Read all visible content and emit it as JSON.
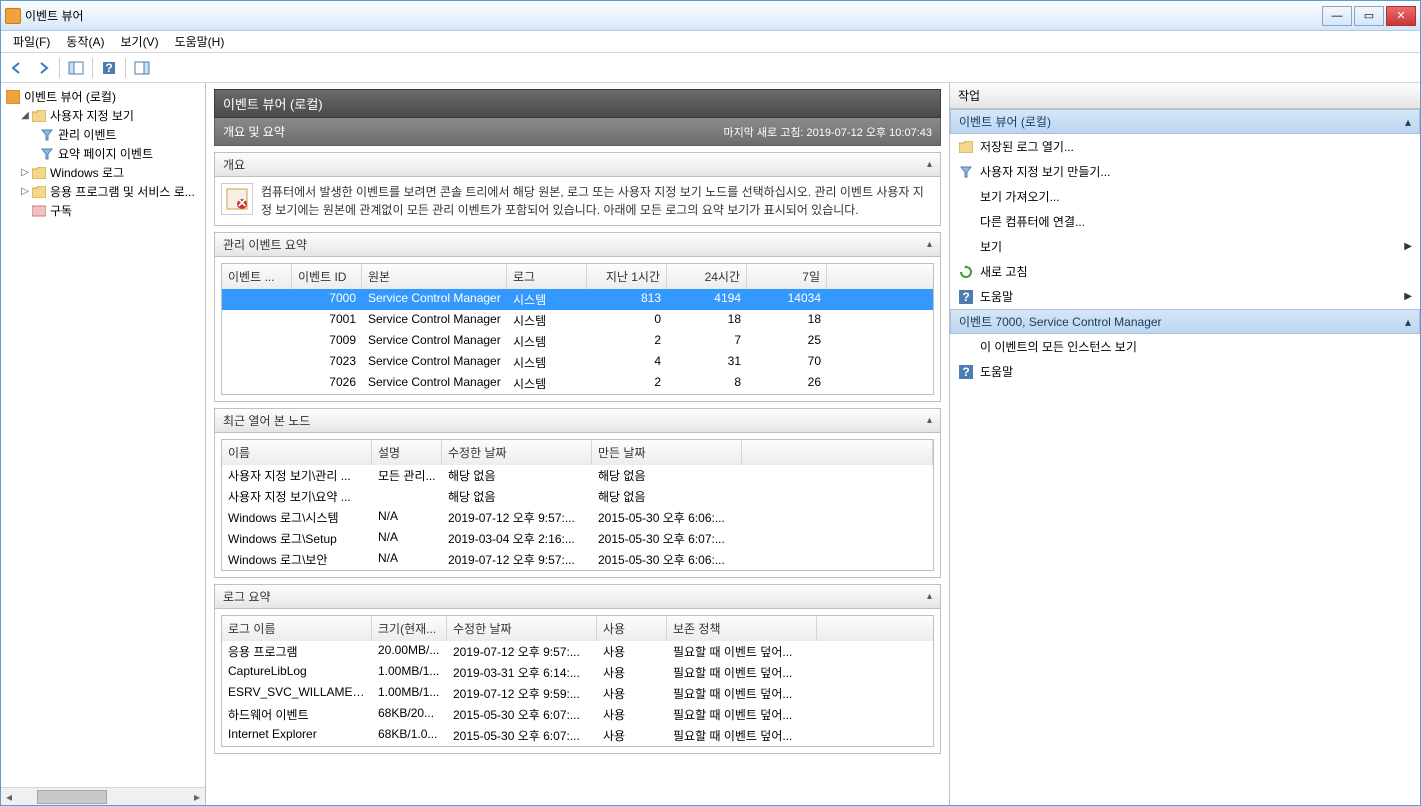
{
  "window": {
    "title": "이벤트 뷰어"
  },
  "menu": {
    "file": "파일(F)",
    "action": "동작(A)",
    "view": "보기(V)",
    "help": "도움말(H)"
  },
  "tree": {
    "root": "이벤트 뷰어 (로컬)",
    "custom_views": "사용자 지정 보기",
    "admin_events": "관리 이벤트",
    "summary_page_events": "요약 페이지 이벤트",
    "windows_logs": "Windows 로그",
    "app_service_logs": "응용 프로그램 및 서비스 로...",
    "subscriptions": "구독"
  },
  "center": {
    "title": "이벤트 뷰어 (로컬)",
    "subtitle": "개요 및 요약",
    "last_refresh": "마지막 새로 고침: 2019-07-12 오후 10:07:43",
    "overview_header": "개요",
    "overview_text": "컴퓨터에서 발생한 이벤트를 보려면 콘솔 트리에서 해당 원본, 로그 또는 사용자 지정 보기 노드를 선택하십시오. 관리 이벤트 사용자 지정 보기에는 원본에 관계없이 모든 관리 이벤트가 포함되어 있습니다. 아래에 모든 로그의 요약 보기가 표시되어 있습니다.",
    "admin_summary_header": "관리 이벤트 요약",
    "admin_summary_cols": [
      "이벤트 ...",
      "이벤트 ID",
      "원본",
      "로그",
      "지난 1시간",
      "24시간",
      "7일"
    ],
    "admin_summary_rows": [
      {
        "type": "",
        "id": "7000",
        "source": "Service Control Manager",
        "log": "시스템",
        "h1": "813",
        "h24": "4194",
        "d7": "14034",
        "selected": true
      },
      {
        "type": "",
        "id": "7001",
        "source": "Service Control Manager",
        "log": "시스템",
        "h1": "0",
        "h24": "18",
        "d7": "18"
      },
      {
        "type": "",
        "id": "7009",
        "source": "Service Control Manager",
        "log": "시스템",
        "h1": "2",
        "h24": "7",
        "d7": "25"
      },
      {
        "type": "",
        "id": "7023",
        "source": "Service Control Manager",
        "log": "시스템",
        "h1": "4",
        "h24": "31",
        "d7": "70"
      },
      {
        "type": "",
        "id": "7026",
        "source": "Service Control Manager",
        "log": "시스템",
        "h1": "2",
        "h24": "8",
        "d7": "26"
      }
    ],
    "recent_header": "최근 열어 본 노드",
    "recent_cols": [
      "이름",
      "설명",
      "수정한 날짜",
      "만든 날짜"
    ],
    "recent_rows": [
      {
        "name": "사용자 지정 보기\\관리 ...",
        "desc": "모든 관리...",
        "mod": "해당 없음",
        "created": "해당 없음"
      },
      {
        "name": "사용자 지정 보기\\요약 ...",
        "desc": "",
        "mod": "해당 없음",
        "created": "해당 없음"
      },
      {
        "name": "Windows 로그\\시스템",
        "desc": "N/A",
        "mod": "2019-07-12 오후 9:57:...",
        "created": "2015-05-30 오후 6:06:..."
      },
      {
        "name": "Windows 로그\\Setup",
        "desc": "N/A",
        "mod": "2019-03-04 오후 2:16:...",
        "created": "2015-05-30 오후 6:07:..."
      },
      {
        "name": "Windows 로그\\보안",
        "desc": "N/A",
        "mod": "2019-07-12 오후 9:57:...",
        "created": "2015-05-30 오후 6:06:..."
      }
    ],
    "log_summary_header": "로그 요약",
    "log_summary_cols": [
      "로그 이름",
      "크기(현재...",
      "수정한 날짜",
      "사용",
      "보존 정책"
    ],
    "log_summary_rows": [
      {
        "name": "응용 프로그램",
        "size": "20.00MB/...",
        "mod": "2019-07-12 오후 9:57:...",
        "enabled": "사용",
        "retention": "필요할 때 이벤트 덮어..."
      },
      {
        "name": "CaptureLibLog",
        "size": "1.00MB/1...",
        "mod": "2019-03-31 오후 6:14:...",
        "enabled": "사용",
        "retention": "필요할 때 이벤트 덮어..."
      },
      {
        "name": "ESRV_SVC_WILLAMETTE",
        "size": "1.00MB/1...",
        "mod": "2019-07-12 오후 9:59:...",
        "enabled": "사용",
        "retention": "필요할 때 이벤트 덮어..."
      },
      {
        "name": "하드웨어 이벤트",
        "size": "68KB/20...",
        "mod": "2015-05-30 오후 6:07:...",
        "enabled": "사용",
        "retention": "필요할 때 이벤트 덮어..."
      },
      {
        "name": "Internet Explorer",
        "size": "68KB/1.0...",
        "mod": "2015-05-30 오후 6:07:...",
        "enabled": "사용",
        "retention": "필요할 때 이벤트 덮어..."
      }
    ]
  },
  "actions": {
    "title": "작업",
    "group1": "이벤트 뷰어 (로컬)",
    "open_saved_log": "저장된 로그 열기...",
    "create_custom_view": "사용자 지정 보기 만들기...",
    "import_view": "보기 가져오기...",
    "connect_other": "다른 컴퓨터에 연결...",
    "view": "보기",
    "refresh": "새로 고침",
    "help": "도움말",
    "group2": "이벤트 7000, Service Control Manager",
    "view_all_instances": "이 이벤트의 모든 인스턴스 보기",
    "help2": "도움말"
  }
}
